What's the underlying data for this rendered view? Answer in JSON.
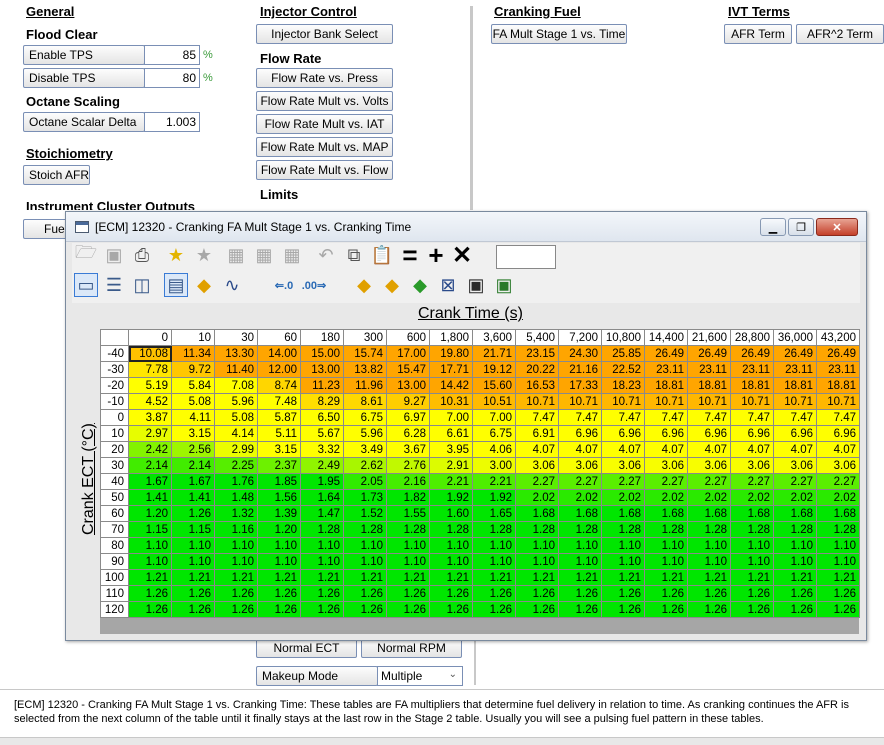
{
  "left_panel": {
    "general_title": "General",
    "flood_clear_title": "Flood Clear",
    "enable_tps_label": "Enable TPS",
    "enable_tps_value": "85",
    "disable_tps_label": "Disable TPS",
    "disable_tps_value": "80",
    "pct_unit": "%",
    "octane_scaling_title": "Octane Scaling",
    "octane_scalar_label": "Octane Scalar Delta",
    "octane_scalar_value": "1.003",
    "stoichiometry_title": "Stoichiometry",
    "stoich_afr_label": "Stoich AFR",
    "instrument_cluster_title": "Instrument Cluster Outputs",
    "fuel_button_partial": "Fuel"
  },
  "middle_panel": {
    "injector_control_title": "Injector Control",
    "injector_bank_select": "Injector Bank Select",
    "flow_rate_title": "Flow Rate",
    "flow_rate_buttons": [
      "Flow Rate vs. Press",
      "Flow Rate Mult vs. Volts",
      "Flow Rate Mult vs. IAT",
      "Flow Rate Mult vs. MAP",
      "Flow Rate Mult vs. Flow"
    ],
    "limits_title": "Limits",
    "normal_ect": "Normal ECT",
    "normal_rpm": "Normal RPM",
    "makeup_mode_label": "Makeup Mode",
    "makeup_mode_value": "Multiple"
  },
  "right_panel": {
    "cranking_fuel_title": "Cranking Fuel",
    "fa_mult_stage1": "FA Mult Stage 1 vs. Time",
    "ivt_terms_title": "IVT Terms",
    "afr_term": "AFR Term",
    "afr2_term": "AFR^2 Term"
  },
  "window": {
    "title": "[ECM] 12320 - Cranking FA Mult Stage 1 vs. Cranking Time",
    "icons": {
      "open": "folder-open-icon",
      "save": "save-icon",
      "print": "print-icon",
      "favorite_add": "star-add-icon",
      "favorite_remove": "star-remove-icon",
      "undo": "undo-icon",
      "copy": "copy-icon",
      "paste": "paste-icon",
      "set": "equals-icon",
      "add": "plus-icon",
      "multiply": "times-icon"
    },
    "x_axis_title": "Crank Time (s)",
    "y_axis_title": "Crank ECT (°C)",
    "columns": [
      "0",
      "10",
      "30",
      "60",
      "180",
      "300",
      "600",
      "1,800",
      "3,600",
      "5,400",
      "7,200",
      "10,800",
      "14,400",
      "21,600",
      "28,800",
      "36,000",
      "43,200"
    ],
    "rows": [
      {
        "h": "-40",
        "v": [
          "10.08",
          "11.34",
          "13.30",
          "14.00",
          "15.00",
          "15.74",
          "17.00",
          "19.80",
          "21.71",
          "23.15",
          "24.30",
          "25.85",
          "26.49",
          "26.49",
          "26.49",
          "26.49",
          "26.49"
        ]
      },
      {
        "h": "-30",
        "v": [
          "7.78",
          "9.72",
          "11.40",
          "12.00",
          "13.00",
          "13.82",
          "15.47",
          "17.71",
          "19.12",
          "20.22",
          "21.16",
          "22.52",
          "23.11",
          "23.11",
          "23.11",
          "23.11",
          "23.11"
        ]
      },
      {
        "h": "-20",
        "v": [
          "5.19",
          "5.84",
          "7.08",
          "8.74",
          "11.23",
          "11.96",
          "13.00",
          "14.42",
          "15.60",
          "16.53",
          "17.33",
          "18.23",
          "18.81",
          "18.81",
          "18.81",
          "18.81",
          "18.81"
        ]
      },
      {
        "h": "-10",
        "v": [
          "4.52",
          "5.08",
          "5.96",
          "7.48",
          "8.29",
          "8.61",
          "9.27",
          "10.31",
          "10.51",
          "10.71",
          "10.71",
          "10.71",
          "10.71",
          "10.71",
          "10.71",
          "10.71",
          "10.71"
        ]
      },
      {
        "h": "0",
        "v": [
          "3.87",
          "4.11",
          "5.08",
          "5.87",
          "6.50",
          "6.75",
          "6.97",
          "7.00",
          "7.00",
          "7.47",
          "7.47",
          "7.47",
          "7.47",
          "7.47",
          "7.47",
          "7.47",
          "7.47"
        ]
      },
      {
        "h": "10",
        "v": [
          "2.97",
          "3.15",
          "4.14",
          "5.11",
          "5.67",
          "5.96",
          "6.28",
          "6.61",
          "6.75",
          "6.91",
          "6.96",
          "6.96",
          "6.96",
          "6.96",
          "6.96",
          "6.96",
          "6.96"
        ]
      },
      {
        "h": "20",
        "v": [
          "2.42",
          "2.56",
          "2.99",
          "3.15",
          "3.32",
          "3.49",
          "3.67",
          "3.95",
          "4.06",
          "4.07",
          "4.07",
          "4.07",
          "4.07",
          "4.07",
          "4.07",
          "4.07",
          "4.07"
        ]
      },
      {
        "h": "30",
        "v": [
          "2.14",
          "2.14",
          "2.25",
          "2.37",
          "2.49",
          "2.62",
          "2.76",
          "2.91",
          "3.00",
          "3.06",
          "3.06",
          "3.06",
          "3.06",
          "3.06",
          "3.06",
          "3.06",
          "3.06"
        ]
      },
      {
        "h": "40",
        "v": [
          "1.67",
          "1.67",
          "1.76",
          "1.85",
          "1.95",
          "2.05",
          "2.16",
          "2.21",
          "2.21",
          "2.27",
          "2.27",
          "2.27",
          "2.27",
          "2.27",
          "2.27",
          "2.27",
          "2.27"
        ]
      },
      {
        "h": "50",
        "v": [
          "1.41",
          "1.41",
          "1.48",
          "1.56",
          "1.64",
          "1.73",
          "1.82",
          "1.92",
          "1.92",
          "2.02",
          "2.02",
          "2.02",
          "2.02",
          "2.02",
          "2.02",
          "2.02",
          "2.02"
        ]
      },
      {
        "h": "60",
        "v": [
          "1.20",
          "1.26",
          "1.32",
          "1.39",
          "1.47",
          "1.52",
          "1.55",
          "1.60",
          "1.65",
          "1.68",
          "1.68",
          "1.68",
          "1.68",
          "1.68",
          "1.68",
          "1.68",
          "1.68"
        ]
      },
      {
        "h": "70",
        "v": [
          "1.15",
          "1.15",
          "1.16",
          "1.20",
          "1.28",
          "1.28",
          "1.28",
          "1.28",
          "1.28",
          "1.28",
          "1.28",
          "1.28",
          "1.28",
          "1.28",
          "1.28",
          "1.28",
          "1.28"
        ]
      },
      {
        "h": "80",
        "v": [
          "1.10",
          "1.10",
          "1.10",
          "1.10",
          "1.10",
          "1.10",
          "1.10",
          "1.10",
          "1.10",
          "1.10",
          "1.10",
          "1.10",
          "1.10",
          "1.10",
          "1.10",
          "1.10",
          "1.10"
        ]
      },
      {
        "h": "90",
        "v": [
          "1.10",
          "1.10",
          "1.10",
          "1.10",
          "1.10",
          "1.10",
          "1.10",
          "1.10",
          "1.10",
          "1.10",
          "1.10",
          "1.10",
          "1.10",
          "1.10",
          "1.10",
          "1.10",
          "1.10"
        ]
      },
      {
        "h": "100",
        "v": [
          "1.21",
          "1.21",
          "1.21",
          "1.21",
          "1.21",
          "1.21",
          "1.21",
          "1.21",
          "1.21",
          "1.21",
          "1.21",
          "1.21",
          "1.21",
          "1.21",
          "1.21",
          "1.21",
          "1.21"
        ]
      },
      {
        "h": "110",
        "v": [
          "1.26",
          "1.26",
          "1.26",
          "1.26",
          "1.26",
          "1.26",
          "1.26",
          "1.26",
          "1.26",
          "1.26",
          "1.26",
          "1.26",
          "1.26",
          "1.26",
          "1.26",
          "1.26",
          "1.26"
        ]
      },
      {
        "h": "120",
        "v": [
          "1.26",
          "1.26",
          "1.26",
          "1.26",
          "1.26",
          "1.26",
          "1.26",
          "1.26",
          "1.26",
          "1.26",
          "1.26",
          "1.26",
          "1.26",
          "1.26",
          "1.26",
          "1.26",
          "1.26"
        ]
      }
    ],
    "heat_colors": {
      "orange": "#ffa500",
      "yellow": "#ffff00",
      "green": "#00e600"
    }
  },
  "status_text": "[ECM] 12320 - Cranking FA Mult Stage 1 vs. Cranking Time: These tables are FA multipliers that determine fuel delivery in relation to time. As cranking continues the AFR is selected from the next column of the table until it finally stays at the last row in the Stage 2 table. Usually you will see a pulsing fuel pattern in these tables."
}
